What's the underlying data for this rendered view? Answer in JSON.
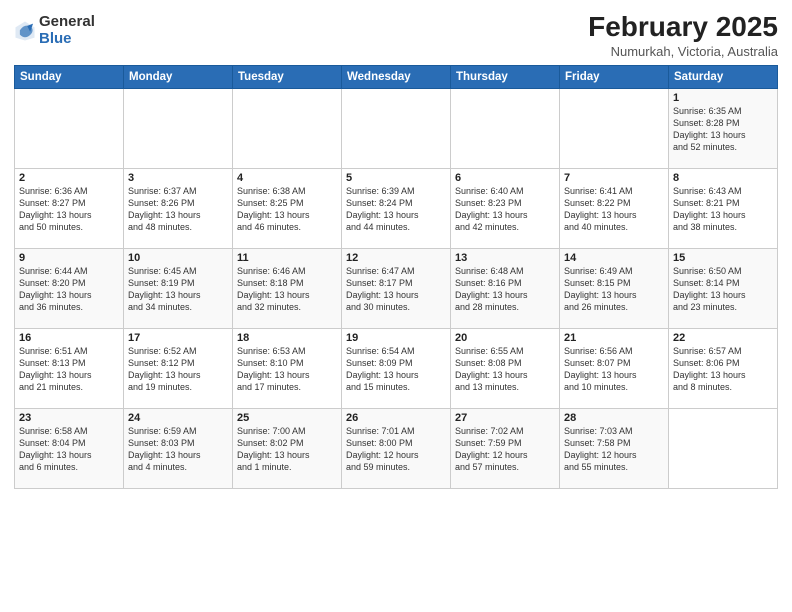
{
  "logo": {
    "general": "General",
    "blue": "Blue"
  },
  "title": "February 2025",
  "subtitle": "Numurkah, Victoria, Australia",
  "days_of_week": [
    "Sunday",
    "Monday",
    "Tuesday",
    "Wednesday",
    "Thursday",
    "Friday",
    "Saturday"
  ],
  "weeks": [
    [
      {
        "day": "",
        "info": ""
      },
      {
        "day": "",
        "info": ""
      },
      {
        "day": "",
        "info": ""
      },
      {
        "day": "",
        "info": ""
      },
      {
        "day": "",
        "info": ""
      },
      {
        "day": "",
        "info": ""
      },
      {
        "day": "1",
        "info": "Sunrise: 6:35 AM\nSunset: 8:28 PM\nDaylight: 13 hours\nand 52 minutes."
      }
    ],
    [
      {
        "day": "2",
        "info": "Sunrise: 6:36 AM\nSunset: 8:27 PM\nDaylight: 13 hours\nand 50 minutes."
      },
      {
        "day": "3",
        "info": "Sunrise: 6:37 AM\nSunset: 8:26 PM\nDaylight: 13 hours\nand 48 minutes."
      },
      {
        "day": "4",
        "info": "Sunrise: 6:38 AM\nSunset: 8:25 PM\nDaylight: 13 hours\nand 46 minutes."
      },
      {
        "day": "5",
        "info": "Sunrise: 6:39 AM\nSunset: 8:24 PM\nDaylight: 13 hours\nand 44 minutes."
      },
      {
        "day": "6",
        "info": "Sunrise: 6:40 AM\nSunset: 8:23 PM\nDaylight: 13 hours\nand 42 minutes."
      },
      {
        "day": "7",
        "info": "Sunrise: 6:41 AM\nSunset: 8:22 PM\nDaylight: 13 hours\nand 40 minutes."
      },
      {
        "day": "8",
        "info": "Sunrise: 6:43 AM\nSunset: 8:21 PM\nDaylight: 13 hours\nand 38 minutes."
      }
    ],
    [
      {
        "day": "9",
        "info": "Sunrise: 6:44 AM\nSunset: 8:20 PM\nDaylight: 13 hours\nand 36 minutes."
      },
      {
        "day": "10",
        "info": "Sunrise: 6:45 AM\nSunset: 8:19 PM\nDaylight: 13 hours\nand 34 minutes."
      },
      {
        "day": "11",
        "info": "Sunrise: 6:46 AM\nSunset: 8:18 PM\nDaylight: 13 hours\nand 32 minutes."
      },
      {
        "day": "12",
        "info": "Sunrise: 6:47 AM\nSunset: 8:17 PM\nDaylight: 13 hours\nand 30 minutes."
      },
      {
        "day": "13",
        "info": "Sunrise: 6:48 AM\nSunset: 8:16 PM\nDaylight: 13 hours\nand 28 minutes."
      },
      {
        "day": "14",
        "info": "Sunrise: 6:49 AM\nSunset: 8:15 PM\nDaylight: 13 hours\nand 26 minutes."
      },
      {
        "day": "15",
        "info": "Sunrise: 6:50 AM\nSunset: 8:14 PM\nDaylight: 13 hours\nand 23 minutes."
      }
    ],
    [
      {
        "day": "16",
        "info": "Sunrise: 6:51 AM\nSunset: 8:13 PM\nDaylight: 13 hours\nand 21 minutes."
      },
      {
        "day": "17",
        "info": "Sunrise: 6:52 AM\nSunset: 8:12 PM\nDaylight: 13 hours\nand 19 minutes."
      },
      {
        "day": "18",
        "info": "Sunrise: 6:53 AM\nSunset: 8:10 PM\nDaylight: 13 hours\nand 17 minutes."
      },
      {
        "day": "19",
        "info": "Sunrise: 6:54 AM\nSunset: 8:09 PM\nDaylight: 13 hours\nand 15 minutes."
      },
      {
        "day": "20",
        "info": "Sunrise: 6:55 AM\nSunset: 8:08 PM\nDaylight: 13 hours\nand 13 minutes."
      },
      {
        "day": "21",
        "info": "Sunrise: 6:56 AM\nSunset: 8:07 PM\nDaylight: 13 hours\nand 10 minutes."
      },
      {
        "day": "22",
        "info": "Sunrise: 6:57 AM\nSunset: 8:06 PM\nDaylight: 13 hours\nand 8 minutes."
      }
    ],
    [
      {
        "day": "23",
        "info": "Sunrise: 6:58 AM\nSunset: 8:04 PM\nDaylight: 13 hours\nand 6 minutes."
      },
      {
        "day": "24",
        "info": "Sunrise: 6:59 AM\nSunset: 8:03 PM\nDaylight: 13 hours\nand 4 minutes."
      },
      {
        "day": "25",
        "info": "Sunrise: 7:00 AM\nSunset: 8:02 PM\nDaylight: 13 hours\nand 1 minute."
      },
      {
        "day": "26",
        "info": "Sunrise: 7:01 AM\nSunset: 8:00 PM\nDaylight: 12 hours\nand 59 minutes."
      },
      {
        "day": "27",
        "info": "Sunrise: 7:02 AM\nSunset: 7:59 PM\nDaylight: 12 hours\nand 57 minutes."
      },
      {
        "day": "28",
        "info": "Sunrise: 7:03 AM\nSunset: 7:58 PM\nDaylight: 12 hours\nand 55 minutes."
      },
      {
        "day": "",
        "info": ""
      }
    ]
  ]
}
